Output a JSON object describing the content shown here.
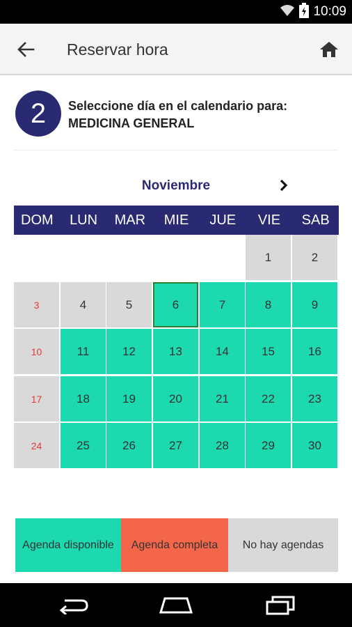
{
  "status_bar": {
    "time": "10:09"
  },
  "app_bar": {
    "title": "Reservar hora"
  },
  "step": {
    "number": "2",
    "line1": "Seleccione día en el calendario para:",
    "line2": "MEDICINA GENERAL"
  },
  "calendar": {
    "month": "Noviembre",
    "weekdays": [
      "DOM",
      "LUN",
      "MAR",
      "MIE",
      "JUE",
      "VIE",
      "SAB"
    ],
    "days": [
      {
        "day": "1",
        "status": "none"
      },
      {
        "day": "2",
        "status": "none"
      },
      {
        "day": "3",
        "status": "none"
      },
      {
        "day": "4",
        "status": "none"
      },
      {
        "day": "5",
        "status": "none"
      },
      {
        "day": "6",
        "status": "available",
        "selected": true
      },
      {
        "day": "7",
        "status": "available"
      },
      {
        "day": "8",
        "status": "available"
      },
      {
        "day": "9",
        "status": "available"
      },
      {
        "day": "10",
        "status": "none"
      },
      {
        "day": "11",
        "status": "available"
      },
      {
        "day": "12",
        "status": "available"
      },
      {
        "day": "13",
        "status": "available"
      },
      {
        "day": "14",
        "status": "available"
      },
      {
        "day": "15",
        "status": "available"
      },
      {
        "day": "16",
        "status": "available"
      },
      {
        "day": "17",
        "status": "none"
      },
      {
        "day": "18",
        "status": "available"
      },
      {
        "day": "19",
        "status": "available"
      },
      {
        "day": "20",
        "status": "available"
      },
      {
        "day": "21",
        "status": "available"
      },
      {
        "day": "22",
        "status": "available"
      },
      {
        "day": "23",
        "status": "available"
      },
      {
        "day": "24",
        "status": "none"
      },
      {
        "day": "25",
        "status": "available"
      },
      {
        "day": "26",
        "status": "available"
      },
      {
        "day": "27",
        "status": "available"
      },
      {
        "day": "28",
        "status": "available"
      },
      {
        "day": "29",
        "status": "available"
      },
      {
        "day": "30",
        "status": "available"
      }
    ]
  },
  "legend": [
    {
      "label": "Agenda disponible",
      "color": "#1cd9b0"
    },
    {
      "label": "Agenda completa",
      "color": "#f4664a"
    },
    {
      "label": "No hay agendas",
      "color": "#d9d9d9"
    }
  ],
  "colors": {
    "primary": "#2a2a73",
    "available": "#1cd9b0",
    "full": "#f4664a",
    "none": "#d9d9d9",
    "sunday_text": "#e53935",
    "selected_border": "#2e7d32"
  }
}
